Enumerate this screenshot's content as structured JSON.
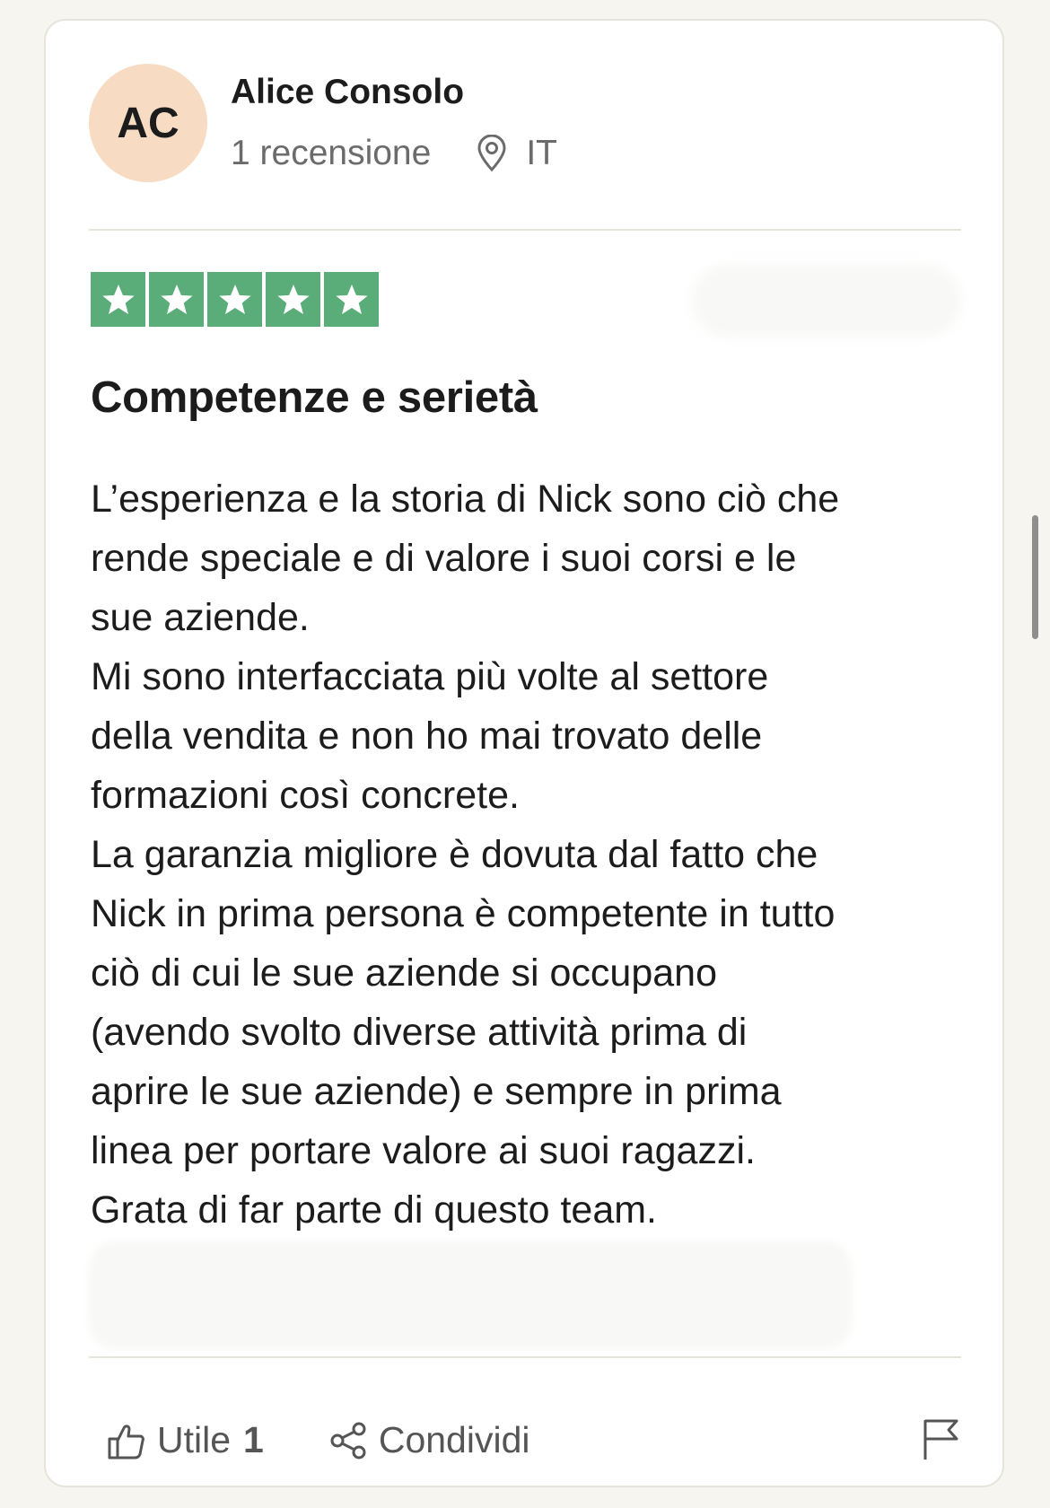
{
  "reviewer": {
    "initials": "AC",
    "name": "Alice Consolo",
    "reviews_count": "1 recensione",
    "country": "IT",
    "avatar_color": "#f7dcc3"
  },
  "rating": {
    "stars": 5,
    "max": 5,
    "color": "#5aad78"
  },
  "review": {
    "title": "Competenze e serietà",
    "lines": [
      "L’esperienza e la storia di Nick sono ciò che",
      "rende speciale e di valore i suoi corsi e le",
      "sue aziende.",
      "Mi sono interfacciata più volte al settore",
      "della vendita e non ho mai trovato delle",
      "formazioni così concrete.",
      "La garanzia migliore è dovuta dal fatto che",
      "Nick in prima persona è competente in tutto",
      "ciò di cui le sue aziende si occupano",
      "(avendo svolto diverse attività prima di",
      "aprire le sue aziende) e sempre in prima",
      "linea per portare valore ai suoi ragazzi.",
      "Grata di far parte di questo team."
    ]
  },
  "actions": {
    "helpful_label": "Utile",
    "helpful_count": "1",
    "share_label": "Condividi",
    "helpful_icon": "thumbs-up-icon",
    "share_icon": "share-icon",
    "flag_icon": "flag-icon"
  }
}
